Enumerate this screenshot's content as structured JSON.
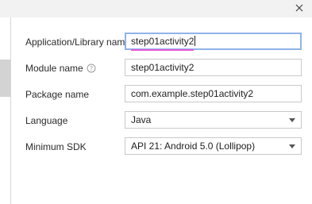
{
  "window": {
    "close_icon": "close-icon"
  },
  "form": {
    "app_name": {
      "label": "Application/Library name",
      "value": "step01activity2"
    },
    "module_name": {
      "label": "Module name",
      "help_icon": "question-circle-icon",
      "value": "step01activity2"
    },
    "package_name": {
      "label": "Package name",
      "value": "com.example.step01activity2"
    },
    "language": {
      "label": "Language",
      "selected": "Java"
    },
    "min_sdk": {
      "label": "Minimum SDK",
      "selected": "API 21: Android 5.0 (Lollipop)"
    }
  },
  "colors": {
    "focus_border": "#8fb3e8",
    "spell_underline": "#e45ad6",
    "field_border": "#c9c9c9",
    "titlebar_bg": "#f2f2f2"
  }
}
